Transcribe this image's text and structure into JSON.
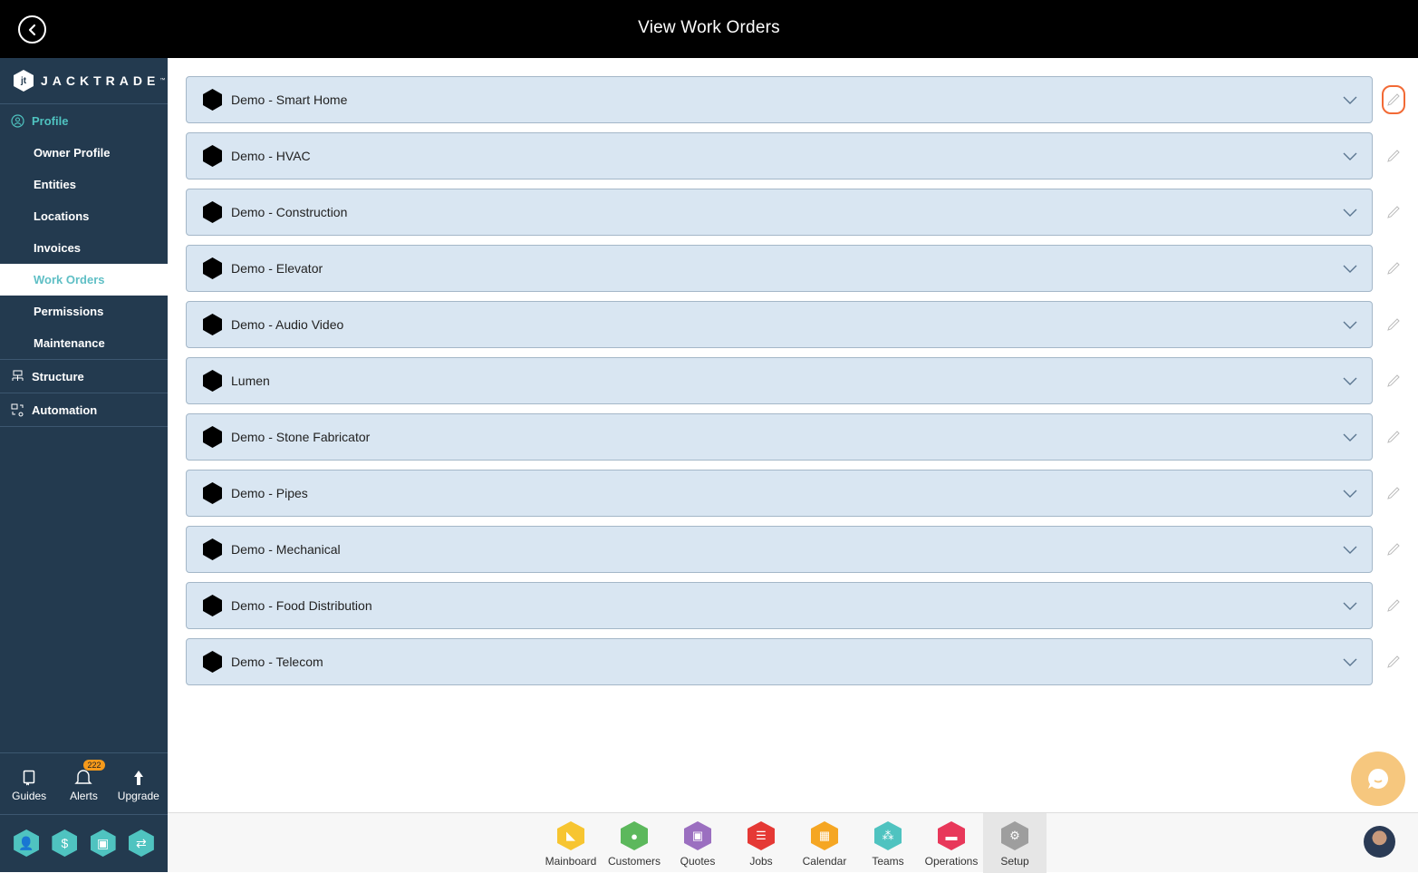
{
  "header": {
    "title": "View Work Orders",
    "back_icon": "chevron-left-circle-icon"
  },
  "brand": {
    "name": "JACKTRADE",
    "tm": "™"
  },
  "sidebar": {
    "sections": [
      {
        "label": "Profile",
        "icon": "user-circle-icon",
        "active": true,
        "items": [
          {
            "label": "Owner Profile"
          },
          {
            "label": "Entities"
          },
          {
            "label": "Locations"
          },
          {
            "label": "Invoices"
          },
          {
            "label": "Work Orders",
            "selected": true
          },
          {
            "label": "Permissions"
          },
          {
            "label": "Maintenance"
          }
        ]
      },
      {
        "label": "Structure",
        "icon": "org-structure-icon"
      },
      {
        "label": "Automation",
        "icon": "automation-icon"
      }
    ],
    "quick": [
      {
        "label": "Guides",
        "icon": "book-icon"
      },
      {
        "label": "Alerts",
        "icon": "bell-icon",
        "badge": "222"
      },
      {
        "label": "Upgrade",
        "icon": "arrow-up-icon"
      }
    ],
    "hex_shortcuts": [
      {
        "icon": "user-icon",
        "glyph": "👤"
      },
      {
        "icon": "dollar-icon",
        "glyph": "$"
      },
      {
        "icon": "money-icon",
        "glyph": "▣"
      },
      {
        "icon": "workflow-icon",
        "glyph": "⇄"
      }
    ],
    "accent": "#4fc3c0"
  },
  "work_orders": [
    {
      "name": "Demo - Smart Home"
    },
    {
      "name": "Demo - HVAC"
    },
    {
      "name": "Demo - Construction"
    },
    {
      "name": "Demo - Elevator"
    },
    {
      "name": "Demo - Audio Video"
    },
    {
      "name": "Lumen"
    },
    {
      "name": "Demo - Stone Fabricator"
    },
    {
      "name": "Demo - Pipes"
    },
    {
      "name": "Demo - Mechanical"
    },
    {
      "name": "Demo - Food Distribution"
    },
    {
      "name": "Demo - Telecom"
    }
  ],
  "apps": [
    {
      "label": "Mainboard",
      "color": "#f7c531",
      "glyph": "◣"
    },
    {
      "label": "Customers",
      "color": "#5cb85c",
      "glyph": "●"
    },
    {
      "label": "Quotes",
      "color": "#9b6fc0",
      "glyph": "▣"
    },
    {
      "label": "Jobs",
      "color": "#e53935",
      "glyph": "☰"
    },
    {
      "label": "Calendar",
      "color": "#f5a623",
      "glyph": "▦"
    },
    {
      "label": "Teams",
      "color": "#4fc3c0",
      "glyph": "⁂"
    },
    {
      "label": "Operations",
      "color": "#e8385a",
      "glyph": "▬"
    },
    {
      "label": "Setup",
      "color": "#9e9e9e",
      "glyph": "⚙",
      "selected": true
    }
  ]
}
